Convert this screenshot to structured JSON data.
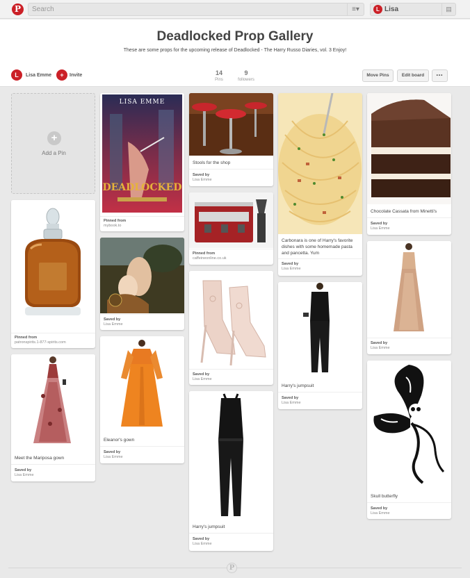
{
  "topbar": {
    "logo_glyph": "P",
    "search_placeholder": "Search",
    "search_menu_glyph": "≡▾",
    "user_initial": "L",
    "user_name": "Lisa",
    "messages_glyph": "▤"
  },
  "board": {
    "title": "Deadlocked Prop Gallery",
    "description": "These are some props for the upcoming release of Deadlocked - The Harry Russo Diaries, vol. 3 Enjoy!",
    "owner_initial": "L",
    "owner_name": "Lisa Emme",
    "invite_glyph": "+",
    "invite_label": "Invite",
    "pins_count": "14",
    "pins_label": "Pins",
    "followers_count": "9",
    "followers_label": "followers",
    "move_pins_label": "Move Pins",
    "edit_board_label": "Edit board",
    "more_label": "•••"
  },
  "add_pin": {
    "glyph": "+",
    "label": "Add a Pin"
  },
  "book_cover": {
    "author": "LISA EMME",
    "title": "DEADLOCKED"
  },
  "pins": [
    {
      "id": "patron",
      "meta_label": "Pinned from",
      "meta_value": "patronspirits.1-877-spirits.com"
    },
    {
      "id": "mariposa",
      "desc": "Meet the Mariposa gown",
      "meta_label": "Saved by",
      "meta_value": "Lisa Emme"
    },
    {
      "id": "book",
      "meta_label": "Pinned from",
      "meta_value": "mybook.to"
    },
    {
      "id": "painting",
      "meta_label": "Saved by",
      "meta_value": "Lisa Emme"
    },
    {
      "id": "eleanor",
      "desc": "Eleanor's gown",
      "meta_label": "Saved by",
      "meta_value": "Lisa Emme"
    },
    {
      "id": "stools",
      "desc": "Stools for the shop",
      "meta_label": "Saved by",
      "meta_value": "Lisa Emme"
    },
    {
      "id": "espresso",
      "meta_label": "Pinned from",
      "meta_value": "caffeineonline.co.uk"
    },
    {
      "id": "boots",
      "meta_label": "Saved by",
      "meta_value": "Lisa Emme"
    },
    {
      "id": "jumpsuit1",
      "desc": "Harry's jumpsuit",
      "meta_label": "Saved by",
      "meta_value": "Lisa Emme"
    },
    {
      "id": "carbonara",
      "desc": "Carbonara is one of Harry's favorite dishes with some homemade pasta and pancetta. Yum",
      "meta_label": "Saved by",
      "meta_value": "Lisa Emme"
    },
    {
      "id": "jumpsuit2",
      "desc": "Harry's jumpsuit",
      "meta_label": "Saved by",
      "meta_value": "Lisa Emme"
    },
    {
      "id": "cake",
      "desc": "Chocolate Cassata from Minetti's",
      "meta_label": "Saved by",
      "meta_value": "Lisa Emme"
    },
    {
      "id": "goldgown",
      "meta_label": "Saved by",
      "meta_value": "Lisa Emme"
    },
    {
      "id": "butterfly",
      "desc": "Skull butterfly",
      "meta_label": "Saved by",
      "meta_value": "Lisa Emme"
    }
  ],
  "footer": {
    "logo_glyph": "P"
  },
  "colors": {
    "brand_red": "#cb2027",
    "page_bg": "#e9e9e9"
  }
}
